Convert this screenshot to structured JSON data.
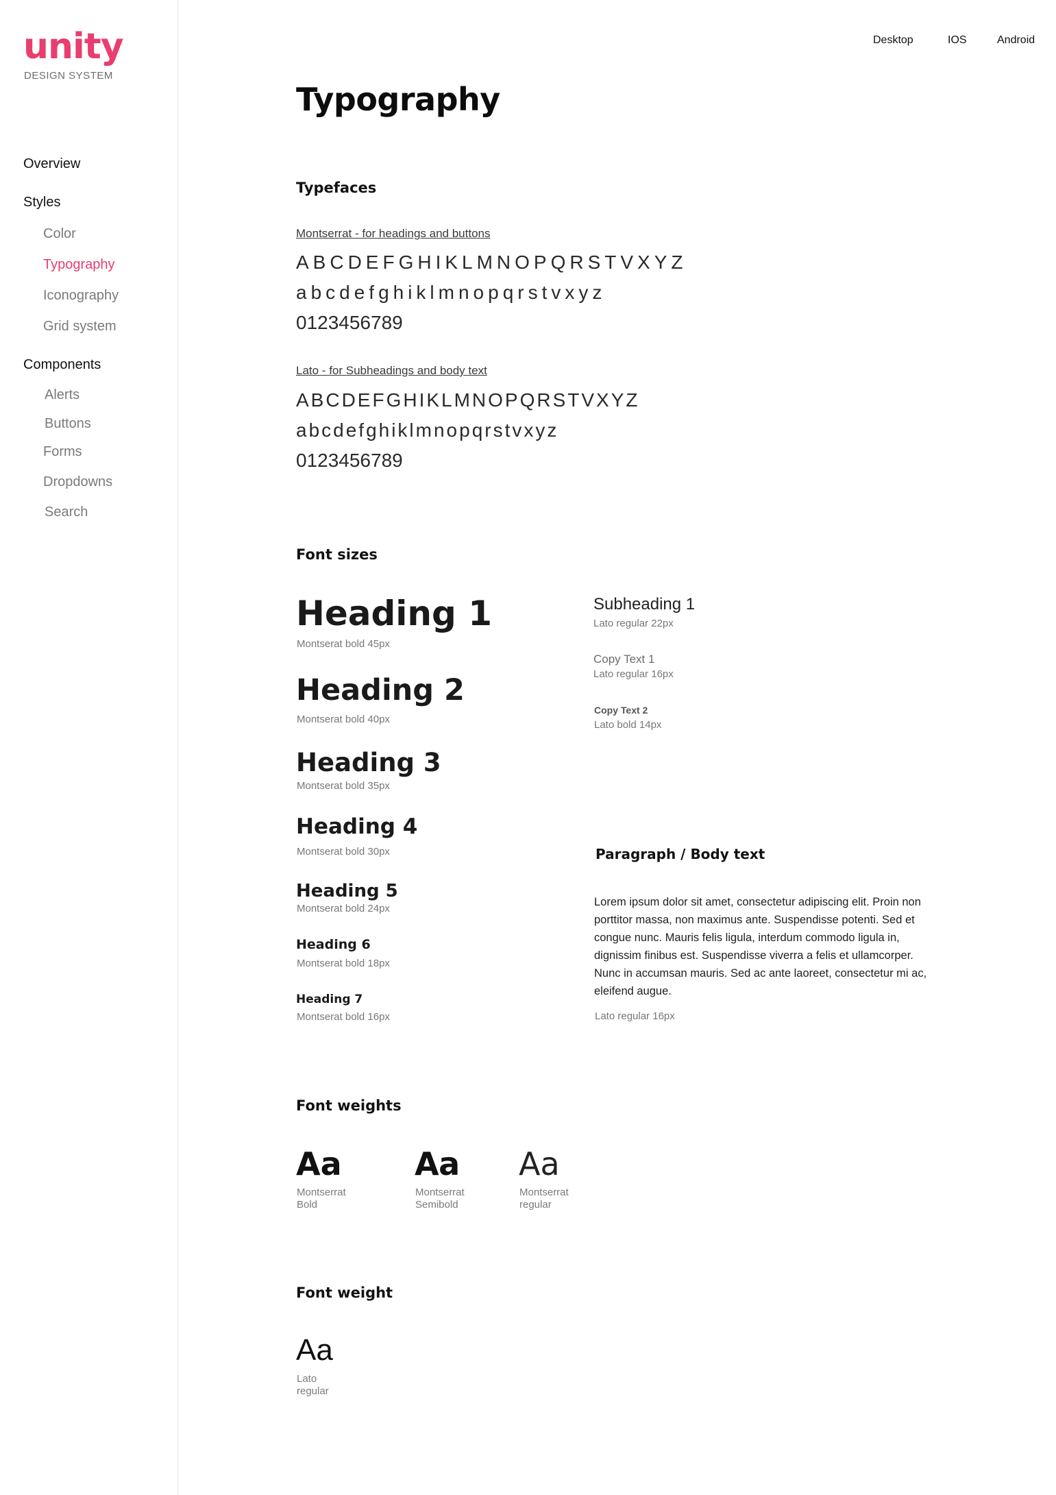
{
  "brand": {
    "logo": "unity",
    "subtitle": "DESIGN SYSTEM",
    "accent": "#e83e70"
  },
  "topnav": [
    "Desktop",
    "IOS",
    "Android"
  ],
  "sidebar": {
    "overview": "Overview",
    "styles": {
      "label": "Styles",
      "items": [
        "Color",
        "Typography",
        "Iconography",
        "Grid system"
      ],
      "active": "Typography"
    },
    "components": {
      "label": "Components",
      "items": [
        "Alerts",
        "Buttons",
        "Forms",
        "Dropdowns",
        "Search"
      ]
    }
  },
  "page_title": "Typography",
  "typefaces": {
    "title": "Typefaces",
    "montserrat": {
      "label": "Montserrat - for headings and buttons",
      "upper": "ABCDEFGHIKLMNOPQRSTVXYZ",
      "lower": "abcdefghiklmnopqrstvxyz",
      "digits": "0123456789"
    },
    "lato": {
      "label": "Lato - for Subheadings and body text",
      "upper": "ABCDEFGHIKLMNOPQRSTVXYZ",
      "lower": "abcdefghiklmnopqrstvxyz",
      "digits": "0123456789"
    }
  },
  "font_sizes": {
    "title": "Font sizes",
    "headings": [
      {
        "label": "Heading 1",
        "caption": "Montserat bold 45px"
      },
      {
        "label": "Heading 2",
        "caption": "Montserat bold 40px"
      },
      {
        "label": "Heading 3",
        "caption": "Montserat bold 35px"
      },
      {
        "label": "Heading 4",
        "caption": "Montserat bold 30px"
      },
      {
        "label": "Heading 5",
        "caption": "Montserat bold 24px"
      },
      {
        "label": "Heading 6",
        "caption": "Montserat bold 18px"
      },
      {
        "label": "Heading 7",
        "caption": "Montserat bold 16px"
      }
    ],
    "subheading": {
      "label": "Subheading 1",
      "caption": "Lato regular 22px"
    },
    "copy1": {
      "label": "Copy Text 1",
      "caption": "Lato regular 16px"
    },
    "copy2": {
      "label": "Copy Text 2",
      "caption": "Lato bold 14px"
    },
    "paragraph": {
      "title": "Paragraph / Body text",
      "text": "Lorem ipsum dolor sit amet, consectetur adipiscing elit. Proin non porttitor massa, non maximus ante. Suspendisse potenti. Sed et congue nunc. Mauris felis ligula, interdum commodo ligula in, dignissim finibus est. Suspendisse viverra a felis et ullamcorper. Nunc in accumsan mauris. Sed ac ante laoreet, consectetur mi ac, eleifend augue.",
      "caption": "Lato regular 16px"
    }
  },
  "font_weights": {
    "title": "Font weights",
    "samples": [
      {
        "glyph": "Aa",
        "line1": "Montserrat",
        "line2": "Bold"
      },
      {
        "glyph": "Aa",
        "line1": "Montserrat",
        "line2": "Semibold"
      },
      {
        "glyph": "Aa",
        "line1": "Montserrat",
        "line2": "regular"
      }
    ]
  },
  "font_weight_lato": {
    "title": "Font weight",
    "sample": {
      "glyph": "Aa",
      "line1": "Lato",
      "line2": "regular"
    }
  }
}
